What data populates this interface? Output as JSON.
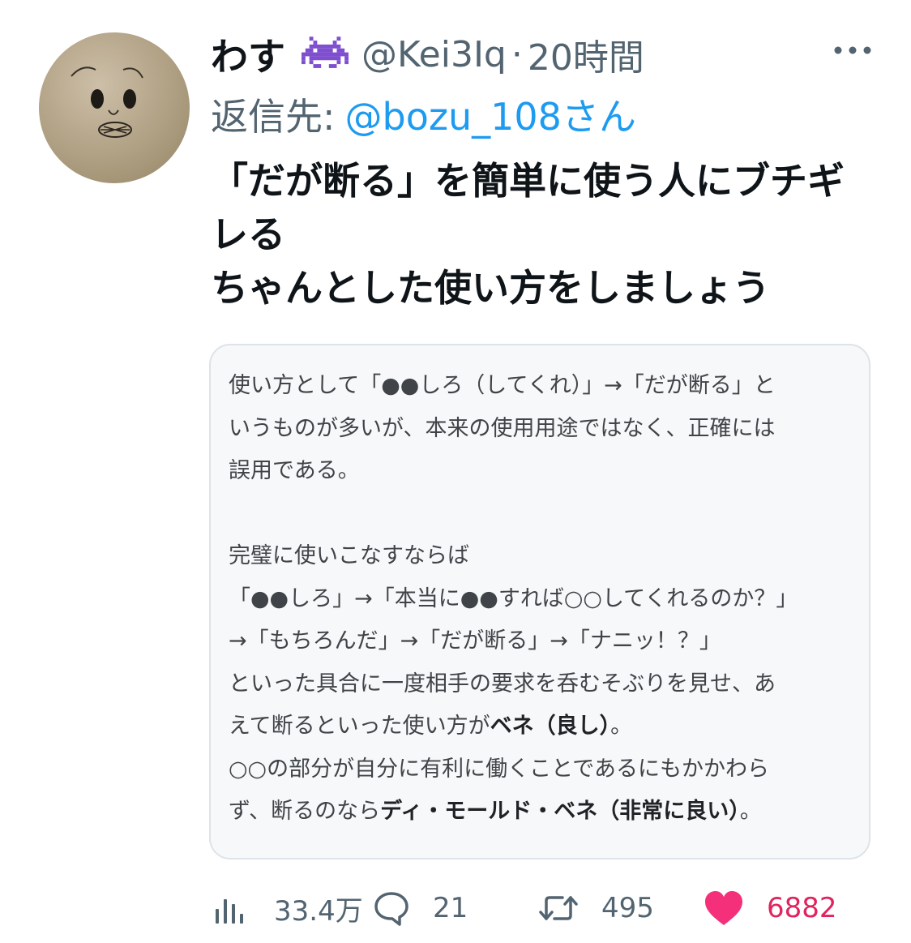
{
  "author": {
    "display_name": "わす",
    "emoji_icon": "alien-monster-icon",
    "handle": "@Kei3Iq",
    "separator": "·",
    "timestamp": "20時間"
  },
  "reply": {
    "prefix": "返信先:",
    "target": "@bozu_108さん"
  },
  "tweet": {
    "lines": [
      "「だが断る」を簡単に使う人にブチギ",
      "レる",
      "ちゃんとした使い方をしましょう"
    ]
  },
  "quote": {
    "line1": "使い方として「●●しろ（してくれ）」→「だが断る」と",
    "line2": "いうものが多いが、本来の使用用途ではなく、正確には",
    "line3": "誤用である。",
    "line4": "完璧に使いこなすならば",
    "line5": "「●●しろ」→「本当に●●すれば○○してくれるのか？」",
    "line6": "→「もちろんだ」→「だが断る」→「ナニッ！？」",
    "line7": "といった具合に一度相手の要求を呑むそぶりを見せ、あ",
    "line8_pre": "えて断るといった使い方が",
    "line8_bold": "ベネ（良し）",
    "line8_post": "。",
    "line9": "○○の部分が自分に有利に働くことであるにもかかわら",
    "line10_pre": "ず、断るのなら",
    "line10_bold": "ディ・モールド・ベネ（非常に良い）",
    "line10_post": "。"
  },
  "actions": {
    "views": "33.4万",
    "replies": "21",
    "retweets": "495",
    "likes": "6882"
  },
  "colors": {
    "text": "#0f1419",
    "secondary": "#536471",
    "link": "#1d9bf0",
    "like": "#e0245e",
    "alien": "#7f4fd0"
  }
}
